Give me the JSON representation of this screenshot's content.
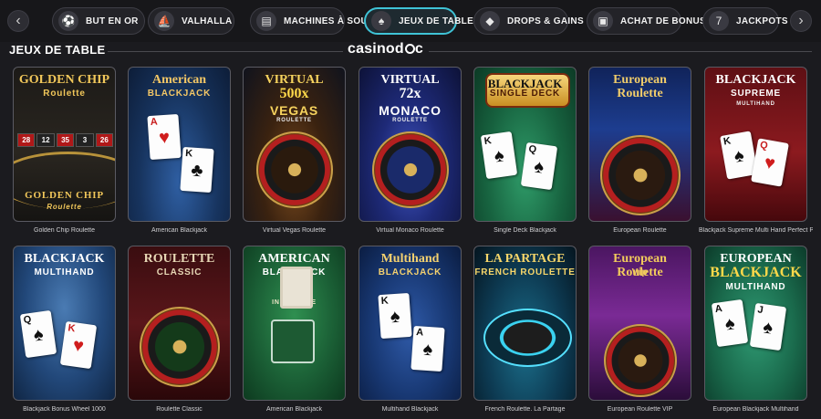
{
  "nav": {
    "prev_icon": "chevron-left-icon",
    "next_icon": "chevron-right-icon",
    "tabs": [
      {
        "label": "But en or",
        "icon": "goal-icon",
        "active": false
      },
      {
        "label": "Valhalla",
        "icon": "ship-icon",
        "active": false
      },
      {
        "label": "Machines à sous",
        "icon": "slot-machine-icon",
        "active": false
      },
      {
        "label": "Jeux de table",
        "icon": "cards-icon",
        "active": true
      },
      {
        "label": "Drops & Gains",
        "icon": "drops-wins-icon",
        "active": false
      },
      {
        "label": "Achat de bonus",
        "icon": "bonus-buy-icon",
        "active": false
      },
      {
        "label": "Jackpots",
        "icon": "jackpot-777-icon",
        "active": false
      }
    ]
  },
  "section": {
    "title": "JEUX DE TABLE"
  },
  "brand": {
    "name_a": "casinod",
    "name_b": "c"
  },
  "colors": {
    "accent": "#3fc3d6",
    "background": "#1b1b1f"
  },
  "games": [
    {
      "title": "Golden Chip Roulette",
      "art_title": "GOLDEN CHIP",
      "art_sub": "Roulette",
      "theme": "goldenchip",
      "numbers": [
        "28",
        "12",
        "35",
        "3",
        "26"
      ],
      "art_footer": "GOLDEN CHIP",
      "art_footer_sub": "Roulette"
    },
    {
      "title": "American Blackjack",
      "art_title": "American",
      "art_sub": "BLACKJACK",
      "theme": "blackjack_blue",
      "cards": [
        {
          "rank": "A",
          "suit": "♥"
        },
        {
          "rank": "K",
          "suit": "♣"
        }
      ]
    },
    {
      "title": "Virtual Vegas Roulette",
      "art_title": "VIRTUAL",
      "art_mid": "500x",
      "art_sub": "VEGAS",
      "art_sub2": "ROULETTE",
      "theme": "vegas"
    },
    {
      "title": "Virtual Monaco Roulette",
      "art_title": "VIRTUAL",
      "art_mid": "72x",
      "art_sub": "MONACO",
      "art_sub2": "ROULETTE",
      "theme": "monaco"
    },
    {
      "title": "Single Deck Blackjack",
      "art_title": "BLACKJACK",
      "art_sub": "SINGLE DECK",
      "theme": "singledeck",
      "cards": [
        {
          "rank": "K",
          "suit": "♠"
        },
        {
          "rank": "Q",
          "suit": "♠"
        }
      ]
    },
    {
      "title": "European Roulette",
      "art_title": "European Roulette",
      "theme": "european"
    },
    {
      "title": "Blackjack Supreme Multi Hand Perfect Pairs",
      "art_title": "BLACKJACK",
      "art_sub": "SUPREME",
      "art_sub2": "MULTIHAND",
      "theme": "supreme",
      "cards": [
        {
          "rank": "K",
          "suit": "♠"
        },
        {
          "rank": "Q",
          "suit": "♥"
        }
      ]
    },
    {
      "title": "Blackjack Bonus Wheel 1000",
      "art_title": "BLACKJACK",
      "art_sub": "MULTIHAND",
      "theme": "bonuswheel",
      "cards": [
        {
          "rank": "Q",
          "suit": "♠"
        },
        {
          "rank": "K",
          "suit": "♥"
        }
      ]
    },
    {
      "title": "Roulette Classic",
      "art_title": "ROULETTE",
      "art_sub": "CLASSIC",
      "theme": "classic"
    },
    {
      "title": "American Blackjack",
      "art_title": "AMERICAN",
      "art_sub": "BLACKJACK",
      "art_note": "INSURANCE",
      "theme": "amer_green"
    },
    {
      "title": "Multihand Blackjack",
      "art_title": "Multihand",
      "art_sub": "BLACKJACK",
      "theme": "multihand",
      "cards": [
        {
          "rank": "K",
          "suit": "♠"
        },
        {
          "rank": "A",
          "suit": "♠"
        }
      ]
    },
    {
      "title": "French Roulette. La Partage",
      "art_title": "LA PARTAGE",
      "art_sub": "FRENCH ROULETTE",
      "theme": "partage"
    },
    {
      "title": "European Roulette VIP",
      "art_title": "European Roulette",
      "art_sub": "Vip",
      "theme": "vip"
    },
    {
      "title": "European Blackjack Multihand",
      "art_title": "EUROPEAN",
      "art_mid": "BLACKJACK",
      "art_sub": "MULTIHAND",
      "theme": "euro_bj",
      "cards": [
        {
          "rank": "A",
          "suit": "♠"
        },
        {
          "rank": "J",
          "suit": "♠"
        }
      ]
    }
  ]
}
